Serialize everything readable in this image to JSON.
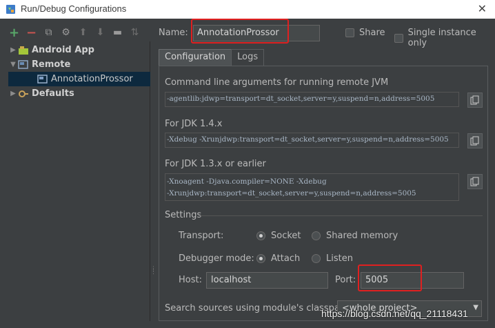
{
  "window": {
    "title": "Run/Debug Configurations",
    "close_glyph": "✕"
  },
  "toolbar": {
    "items": [
      {
        "name": "add-icon",
        "glyph": "+"
      },
      {
        "name": "remove-icon",
        "glyph": "−"
      },
      {
        "name": "copy-config-icon",
        "glyph": "⧉"
      },
      {
        "name": "edit-defaults-icon",
        "glyph": "⚙"
      },
      {
        "name": "move-up-icon",
        "glyph": "⬆"
      },
      {
        "name": "move-down-icon",
        "glyph": "⬇"
      },
      {
        "name": "folder-icon",
        "glyph": "▬"
      },
      {
        "name": "sort-icon",
        "glyph": "⇅"
      }
    ]
  },
  "tree": {
    "items": [
      {
        "label": "Android App",
        "arrow": "▶",
        "level": 0
      },
      {
        "label": "Remote",
        "arrow": "▼",
        "level": 0
      },
      {
        "label": "AnnotationProssor",
        "arrow": "",
        "level": 1
      },
      {
        "label": "Defaults",
        "arrow": "▶",
        "level": 0
      }
    ]
  },
  "config": {
    "name_label": "Name:",
    "name_value": "AnnotationProssor",
    "share_label": "Share",
    "single_instance_label": "Single instance only",
    "tabs": [
      {
        "label": "Configuration",
        "active": true
      },
      {
        "label": "Logs",
        "active": false
      }
    ]
  },
  "jvm": {
    "remote_label": "Command line arguments for running remote JVM",
    "remote_args": "-agentlib:jdwp=transport=dt_socket,server=y,suspend=n,address=5005",
    "jdk14_label": "For JDK 1.4.x",
    "jdk14_args": "-Xdebug -Xrunjdwp:transport=dt_socket,server=y,suspend=n,address=5005",
    "jdk13_label": "For JDK 1.3.x or earlier",
    "jdk13_args_line1": "-Xnoagent -Djava.compiler=NONE -Xdebug",
    "jdk13_args_line2": "-Xrunjdwp:transport=dt_socket,server=y,suspend=n,address=5005"
  },
  "settings": {
    "section_label": "Settings",
    "transport_label": "Transport:",
    "transport_options": [
      {
        "label": "Socket",
        "selected": true
      },
      {
        "label": "Shared memory",
        "selected": false
      }
    ],
    "debugger_mode_label": "Debugger mode:",
    "debugger_mode_options": [
      {
        "label": "Attach",
        "selected": true
      },
      {
        "label": "Listen",
        "selected": false
      }
    ],
    "host_label": "Host:",
    "host_value": "localhost",
    "port_label": "Port:",
    "port_value": "5005",
    "classpath_label": "Search sources using module's classpath:",
    "classpath_value": "<whole project>"
  },
  "watermark": "https://blog.csdn.net/qq_21118431",
  "colors": {
    "highlight": "#e02020",
    "selection": "#0d293e",
    "background": "#3c3f41"
  }
}
